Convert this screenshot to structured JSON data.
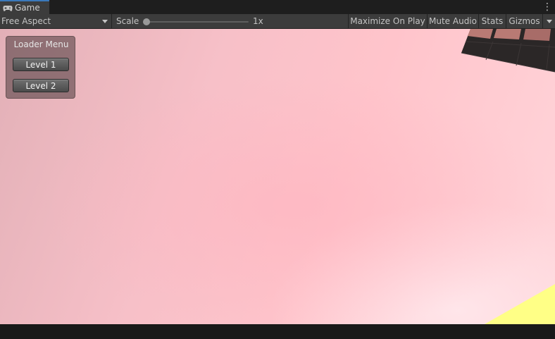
{
  "tab": {
    "label": "Game",
    "icon": "gamepad-icon"
  },
  "toolbar": {
    "aspect_label": "Free Aspect",
    "scale_label": "Scale",
    "scale_value": "1x",
    "scale_fraction": 0.0,
    "maximize_label": "Maximize On Play",
    "mute_label": "Mute Audio",
    "stats_label": "Stats",
    "gizmos_label": "Gizmos"
  },
  "game": {
    "menu_title": "Loader Menu",
    "buttons": [
      {
        "label": "Level 1"
      },
      {
        "label": "Level 2"
      }
    ]
  },
  "colors": {
    "accent": "#3a79bb",
    "background": "#ffc4cb",
    "floor_tile": "#b97a74",
    "floor_dark": "#2b2727",
    "yellow_plane": "#ffff86"
  }
}
